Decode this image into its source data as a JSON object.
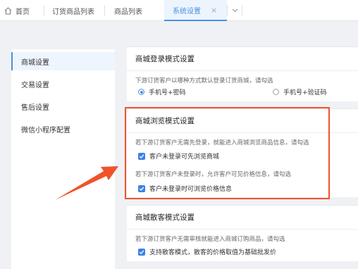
{
  "tabs": {
    "home": "首页",
    "orders": "订货商品列表",
    "products": "商品列表",
    "settings": "系统设置",
    "close_glyph": "×"
  },
  "sidebar": {
    "items": [
      {
        "label": "商城设置",
        "active": true
      },
      {
        "label": "交易设置",
        "active": false
      },
      {
        "label": "售后设置",
        "active": false
      },
      {
        "label": "微信小程序配置",
        "active": false
      }
    ]
  },
  "login_mode": {
    "title": "商城登录模式设置",
    "hint": "下游订货客户以哪种方式默认登录订货商城，请勾选",
    "options": [
      {
        "label": "手机号+密码",
        "selected": true
      },
      {
        "label": "手机号+验证码",
        "selected": false
      }
    ]
  },
  "browse_mode": {
    "title": "商城浏览模式设置",
    "hint1": "若下游订货客户无需先登录，就能进入商城浏览商品信息，请勾选",
    "check1": {
      "label": "客户未登录可先浏览商城",
      "checked": true
    },
    "hint2": "若下游订货客户未登录时，允许客户可见价格信息，请勾选",
    "check2": {
      "label": "客户未登录时可浏览价格信息",
      "checked": true
    }
  },
  "guest_mode": {
    "title": "商城散客模式设置",
    "hint": "若下游订货客户无需审核就能进入商城订购商品，请勾选",
    "check": {
      "label": "支持散客模式，散客的价格取值为基础批发价",
      "checked": true
    }
  },
  "colors": {
    "accent": "#4a90e2",
    "highlight": "#f0532a",
    "checkbox": "#3b82e6"
  },
  "icons": [
    "home-icon",
    "close-icon",
    "chevron-down-icon",
    "check-icon",
    "arrow-pointer"
  ]
}
